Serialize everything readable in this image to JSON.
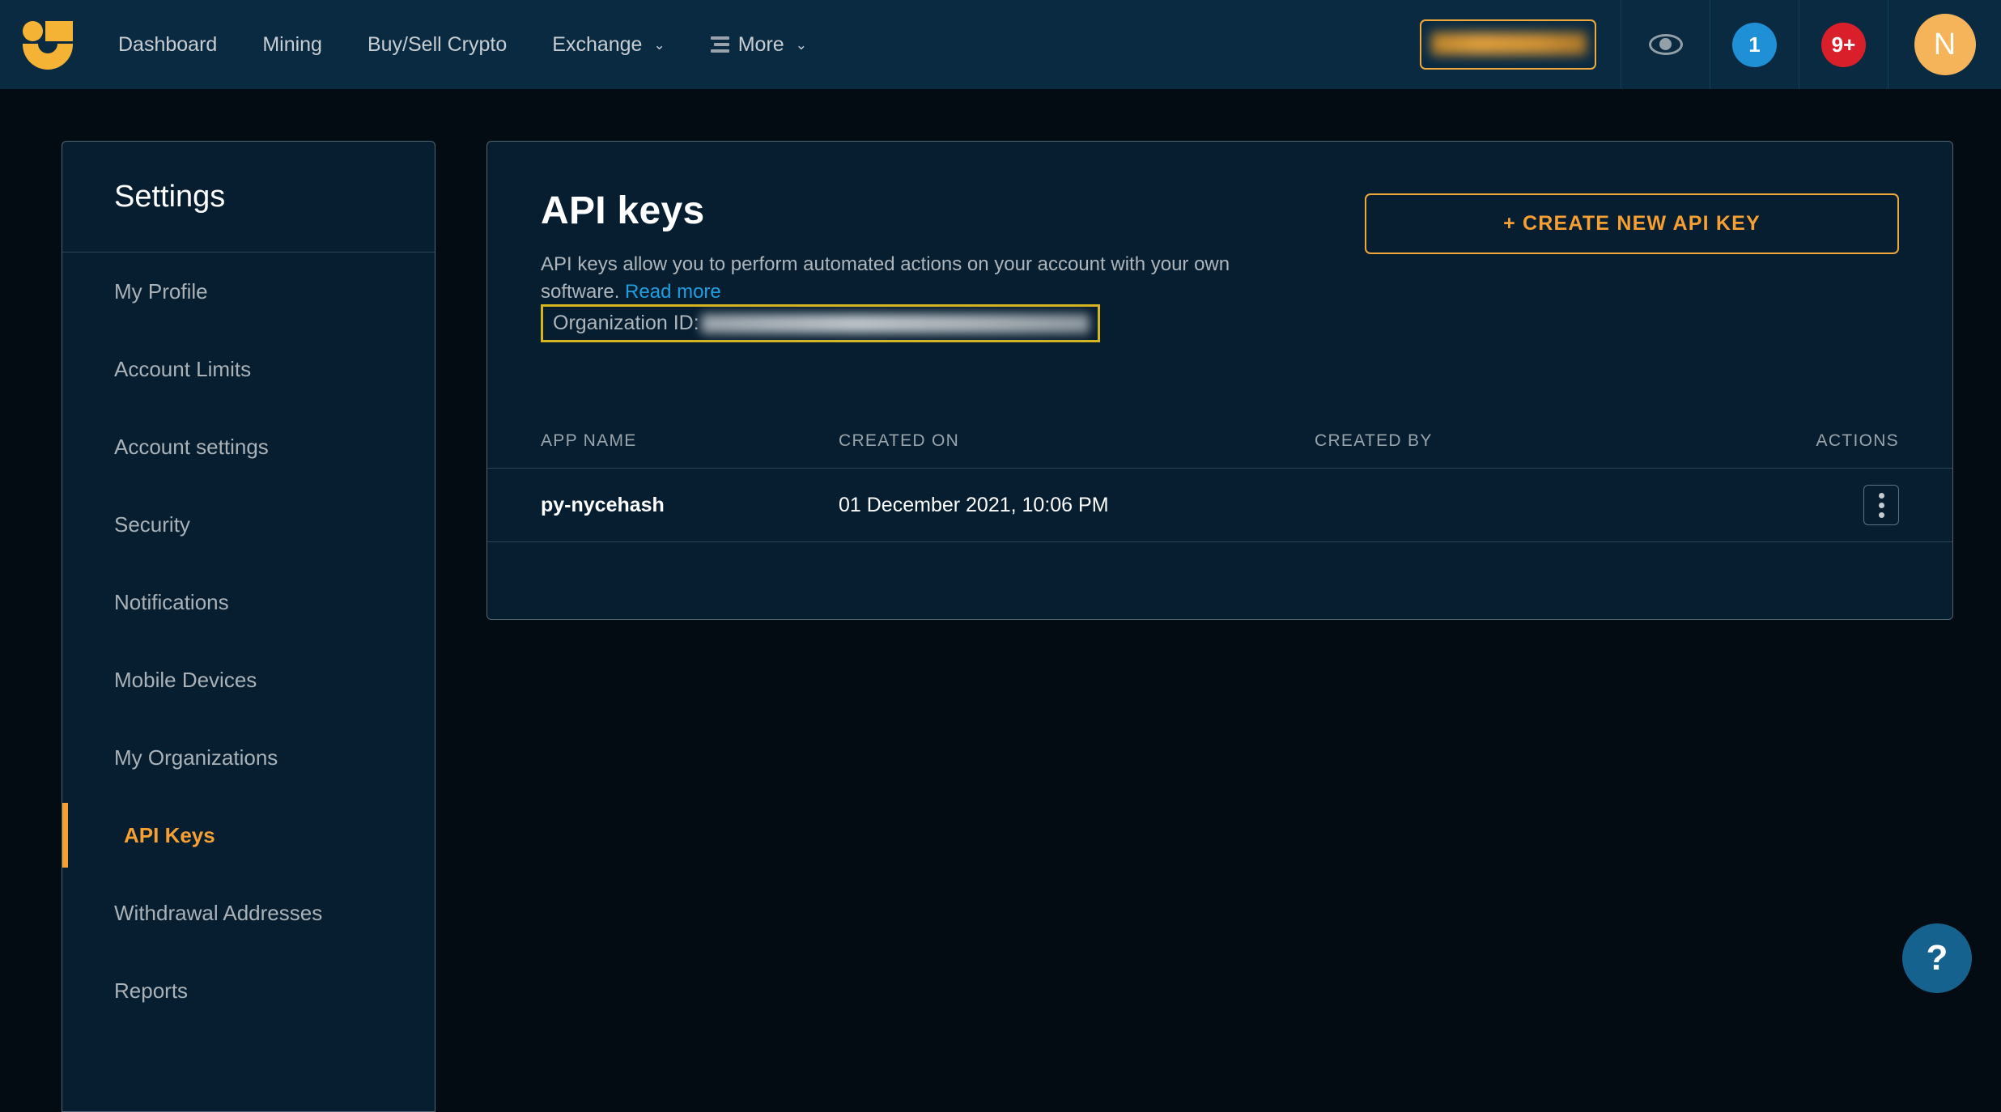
{
  "header": {
    "logo_name": "nicehash-logo",
    "nav": [
      {
        "label": "Dashboard",
        "has_caret": false,
        "has_hamburger": false
      },
      {
        "label": "Mining",
        "has_caret": false,
        "has_hamburger": false
      },
      {
        "label": "Buy/Sell Crypto",
        "has_caret": false,
        "has_hamburger": false
      },
      {
        "label": "Exchange",
        "has_caret": true,
        "has_hamburger": false
      },
      {
        "label": "More",
        "has_caret": true,
        "has_hamburger": true
      }
    ],
    "caret_glyph": "⌄",
    "balance_hidden": true,
    "eye_icon": "eye-icon",
    "notification_badge": "1",
    "alert_badge": "9+",
    "avatar_initial": "N",
    "accent_color": "#f0a83c",
    "badge_blue": "#1f8fd6",
    "badge_red": "#d81f2a",
    "bar_color": "#0a2a42"
  },
  "sidebar": {
    "title": "Settings",
    "items": [
      {
        "label": "My Profile",
        "active": false
      },
      {
        "label": "Account Limits",
        "active": false
      },
      {
        "label": "Account settings",
        "active": false
      },
      {
        "label": "Security",
        "active": false
      },
      {
        "label": "Notifications",
        "active": false
      },
      {
        "label": "Mobile Devices",
        "active": false
      },
      {
        "label": "My Organizations",
        "active": false
      },
      {
        "label": "API Keys",
        "active": true
      },
      {
        "label": "Withdrawal Addresses",
        "active": false
      },
      {
        "label": "Reports",
        "active": false
      }
    ],
    "active_color": "#f6a033"
  },
  "main": {
    "title": "API keys",
    "description_part1": "API keys allow you to perform automated actions on your account with your own software. ",
    "read_more_label": "Read more",
    "organization_label": "Organization ID:",
    "organization_value_hidden": true,
    "organization_highlight_color": "#d6b51e",
    "create_button_label": "+ CREATE NEW API KEY",
    "table": {
      "columns": [
        "APP NAME",
        "CREATED ON",
        "CREATED BY",
        "ACTIONS"
      ],
      "rows": [
        {
          "app_name": "py-nycehash",
          "created_on": "01 December 2021, 10:06 PM",
          "created_by_hidden": true,
          "actions_icon": "kebab-menu-icon"
        }
      ]
    }
  },
  "help": {
    "label": "?"
  }
}
